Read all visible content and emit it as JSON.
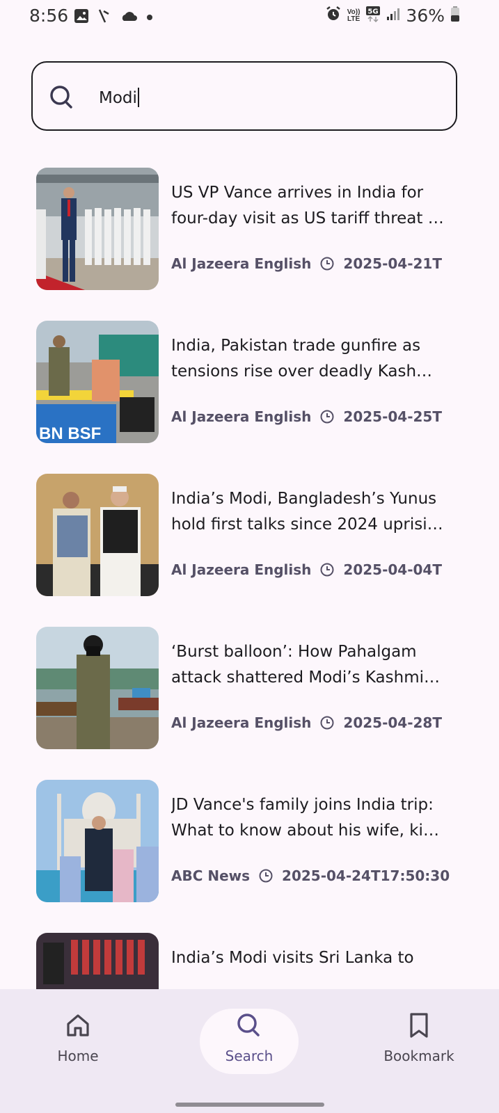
{
  "status_bar": {
    "time": "8:56",
    "battery": "36%",
    "volte": "Vo)) LTE",
    "network": "5G"
  },
  "search": {
    "query": "Modi",
    "icon": "search-icon"
  },
  "results": [
    {
      "title": "US VP Vance arrives in India for four-day visit as US tariff threat …",
      "source": "Al Jazeera English",
      "date": "2025-04-21T"
    },
    {
      "title": "India, Pakistan trade gunfire as tensions rise over deadly Kash…",
      "source": "Al Jazeera English",
      "date": "2025-04-25T"
    },
    {
      "title": "India’s Modi, Bangladesh’s Yunus hold first talks since 2024 uprisi…",
      "source": "Al Jazeera English",
      "date": "2025-04-04T"
    },
    {
      "title": "‘Burst balloon’: How Pahalgam attack shattered Modi’s Kashmi…",
      "source": "Al Jazeera English",
      "date": "2025-04-28T"
    },
    {
      "title": "JD Vance's family joins India trip: What to know about his wife, ki…",
      "source": "ABC News",
      "date": "2025-04-24T17:50:30"
    },
    {
      "title": "India’s Modi visits Sri Lanka to",
      "source": "",
      "date": ""
    }
  ],
  "nav": {
    "home": "Home",
    "search": "Search",
    "bookmark": "Bookmark",
    "active": "search",
    "active_color": "#5a4f8a"
  }
}
